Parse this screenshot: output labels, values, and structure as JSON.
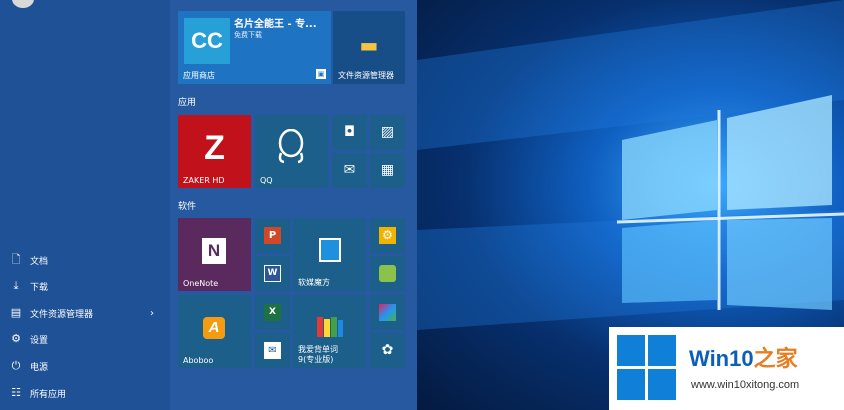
{
  "left_nav": {
    "items": [
      {
        "label": "文档",
        "icon": "document-icon"
      },
      {
        "label": "下载",
        "icon": "download-icon"
      },
      {
        "label": "文件资源管理器",
        "icon": "file-explorer-icon",
        "arrow": "›"
      },
      {
        "label": "设置",
        "icon": "gear-icon"
      },
      {
        "label": "电源",
        "icon": "power-icon"
      },
      {
        "label": "所有应用",
        "icon": "all-apps-icon"
      }
    ]
  },
  "groups": {
    "apps": "应用",
    "software": "软件"
  },
  "tiles": {
    "store": {
      "title": "名片全能王 - 专...",
      "subtitle": "免费下载",
      "label": "应用商店",
      "logo_text": "CC"
    },
    "file_explorer": {
      "label": "文件资源管理器"
    },
    "zaker": {
      "label": "ZAKER HD",
      "logo_text": "Z"
    },
    "qq": {
      "label": "QQ"
    },
    "onenote": {
      "label": "OneNote",
      "logo_text": "N"
    },
    "softmagic": {
      "label": "软媒魔方"
    },
    "aboboo": {
      "label": "Aboboo",
      "logo_text": "A"
    },
    "vocab": {
      "label": "我爱背单词\n9(专业版)"
    },
    "ppt": {
      "logo_text": "P"
    },
    "word": {
      "logo_text": "W"
    },
    "excel": {
      "logo_text": "X"
    },
    "outlook": {
      "logo_text": "✉"
    }
  },
  "watermark": {
    "title_a": "Win10",
    "title_b": "之家",
    "url": "www.win10xitong.com"
  },
  "colors": {
    "accent": "#1e74c2",
    "zaker": "#c1121c",
    "onenote": "#5a2a5e",
    "watermark_blue": "#0b5fb7"
  }
}
